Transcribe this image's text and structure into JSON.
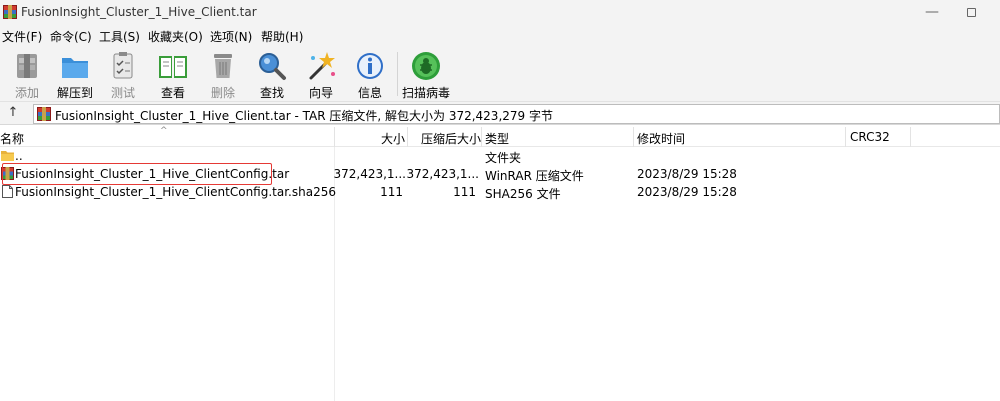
{
  "window": {
    "title": "FusionInsight_Cluster_1_Hive_Client.tar",
    "minimize_glyph": "—"
  },
  "menu": [
    "文件(F)",
    "命令(C)",
    "工具(S)",
    "收藏夹(O)",
    "选项(N)",
    "帮助(H)"
  ],
  "toolbar": {
    "add": "添加",
    "extract": "解压到",
    "test": "测试",
    "view": "查看",
    "delete": "删除",
    "find": "查找",
    "wizard": "向导",
    "info": "信息",
    "scan": "扫描病毒"
  },
  "address": {
    "up_glyph": "↑",
    "text": "FusionInsight_Cluster_1_Hive_Client.tar - TAR 压缩文件, 解包大小为 372,423,279 字节"
  },
  "columns": {
    "name": "名称",
    "size": "大小",
    "packed": "压缩后大小",
    "type": "类型",
    "modified": "修改时间",
    "crc": "CRC32",
    "sort_glyph": "^"
  },
  "rows": [
    {
      "name": "..",
      "size": "",
      "packed": "",
      "type": "文件夹",
      "modified": "",
      "icon": "folder-icon"
    },
    {
      "name": "FusionInsight_Cluster_1_Hive_ClientConfig.tar",
      "size": "372,423,1...",
      "packed": "372,423,1...",
      "type": "WinRAR 压缩文件",
      "modified": "2023/8/29 15:28",
      "icon": "winrar-archive-icon"
    },
    {
      "name": "FusionInsight_Cluster_1_Hive_ClientConfig.tar.sha256",
      "size": "111",
      "packed": "111",
      "type": "SHA256 文件",
      "modified": "2023/8/29 15:28",
      "icon": "file-icon"
    }
  ],
  "colors": {
    "highlight_border": "#e53935",
    "chrome_bg": "#f3f3f3"
  }
}
